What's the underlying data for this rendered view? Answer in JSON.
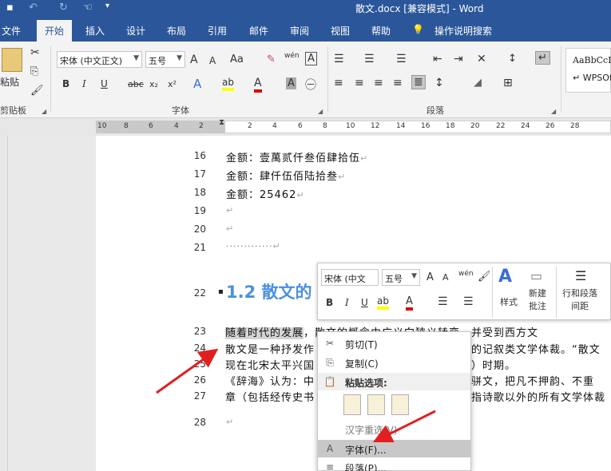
{
  "window": {
    "title": "散文.docx [兼容模式]  -  Word"
  },
  "tabs": [
    {
      "label": "文件"
    },
    {
      "label": "开始",
      "active": true
    },
    {
      "label": "插入"
    },
    {
      "label": "设计"
    },
    {
      "label": "布局"
    },
    {
      "label": "引用"
    },
    {
      "label": "邮件"
    },
    {
      "label": "审阅"
    },
    {
      "label": "视图"
    },
    {
      "label": "帮助"
    },
    {
      "label": "操作说明搜索"
    }
  ],
  "ribbon": {
    "clipboard": {
      "paste_label": "粘贴",
      "group_label": "剪贴板"
    },
    "font": {
      "font_name": "宋体 (中文正文)",
      "font_size": "五号",
      "grow": "A",
      "shrink": "A",
      "case": "Aa",
      "phonetic": "wén",
      "border_char": "A",
      "bold": "B",
      "italic": "I",
      "underline": "U",
      "strike": "abc",
      "subscript": "x₂",
      "superscript": "x²",
      "text_effect": "A",
      "highlight": "ab",
      "font_color": "A",
      "shade": "A",
      "enclose": "㊀",
      "group_label": "字体"
    },
    "paragraph": {
      "group_label": "段落"
    },
    "styles": {
      "sample1": "AaBbCcI",
      "sample2": "↵ WPSOf"
    }
  },
  "ruler": {
    "ticks": [
      "10",
      "8",
      "6",
      "4",
      "2",
      "2",
      "4",
      "6",
      "8",
      "10",
      "12",
      "14",
      "16",
      "18",
      "20",
      "22",
      "24",
      "26",
      "28"
    ]
  },
  "document": {
    "lines": [
      {
        "num": "16",
        "text": "金额：壹萬贰仟叁佰肆拾伍"
      },
      {
        "num": "17",
        "text": "金额：肆仟伍佰陆拾叁"
      },
      {
        "num": "18",
        "text": "金额：25462"
      },
      {
        "num": "19",
        "text": ""
      },
      {
        "num": "20",
        "text": ""
      },
      {
        "num": "21",
        "text": "·············"
      },
      {
        "num": "22",
        "text": ""
      },
      {
        "num": "23",
        "text": ""
      },
      {
        "num": "24",
        "text": ""
      },
      {
        "num": "25",
        "text": ""
      },
      {
        "num": "26",
        "text": ""
      },
      {
        "num": "27",
        "text": ""
      },
      {
        "num": "28",
        "text": ""
      }
    ],
    "heading": "1.2 散文的",
    "para_line23_sel": "随着时代的发展",
    "para_line23_rest": "，散文的概念由广义向狭义转变，并受到西方文",
    "para_line24_a": "散文是一种抒发作",
    "para_line24_b": "的记叙类文学体裁。“散文",
    "para_line25_a": "现在北宋太平兴国",
    "para_line25_b": "）时期。",
    "para_line26_a": "《辞海》认为：中",
    "para_line26_b": "骈文，把凡不押韵、不重",
    "para_line27_a": "章（包括经传史书",
    "para_line27_b": "指诗歌以外的所有文学体裁"
  },
  "mini_toolbar": {
    "font_name": "宋体 (中文",
    "font_size": "五号",
    "style_label": "样式",
    "new_comment_label": "新建\n批注",
    "line_spacing_label": "行和段落\n间距"
  },
  "context_menu": {
    "items": [
      {
        "label": "剪切(T)",
        "icon": "✂"
      },
      {
        "label": "复制(C)",
        "icon": "⎘"
      },
      {
        "label": "粘贴选项:",
        "icon": "📋",
        "header": true
      },
      {
        "label": "汉字重选(V)",
        "disabled": true
      },
      {
        "label": "字体(F)...",
        "icon": "A",
        "highlight": true
      },
      {
        "label": "段落(P)...",
        "icon": "≡"
      }
    ]
  },
  "colors": {
    "brand": "#2b579a",
    "heading": "#4a90e2",
    "arrow": "#e02020",
    "highlight_yellow": "#ffff00",
    "font_red": "#e00000"
  }
}
